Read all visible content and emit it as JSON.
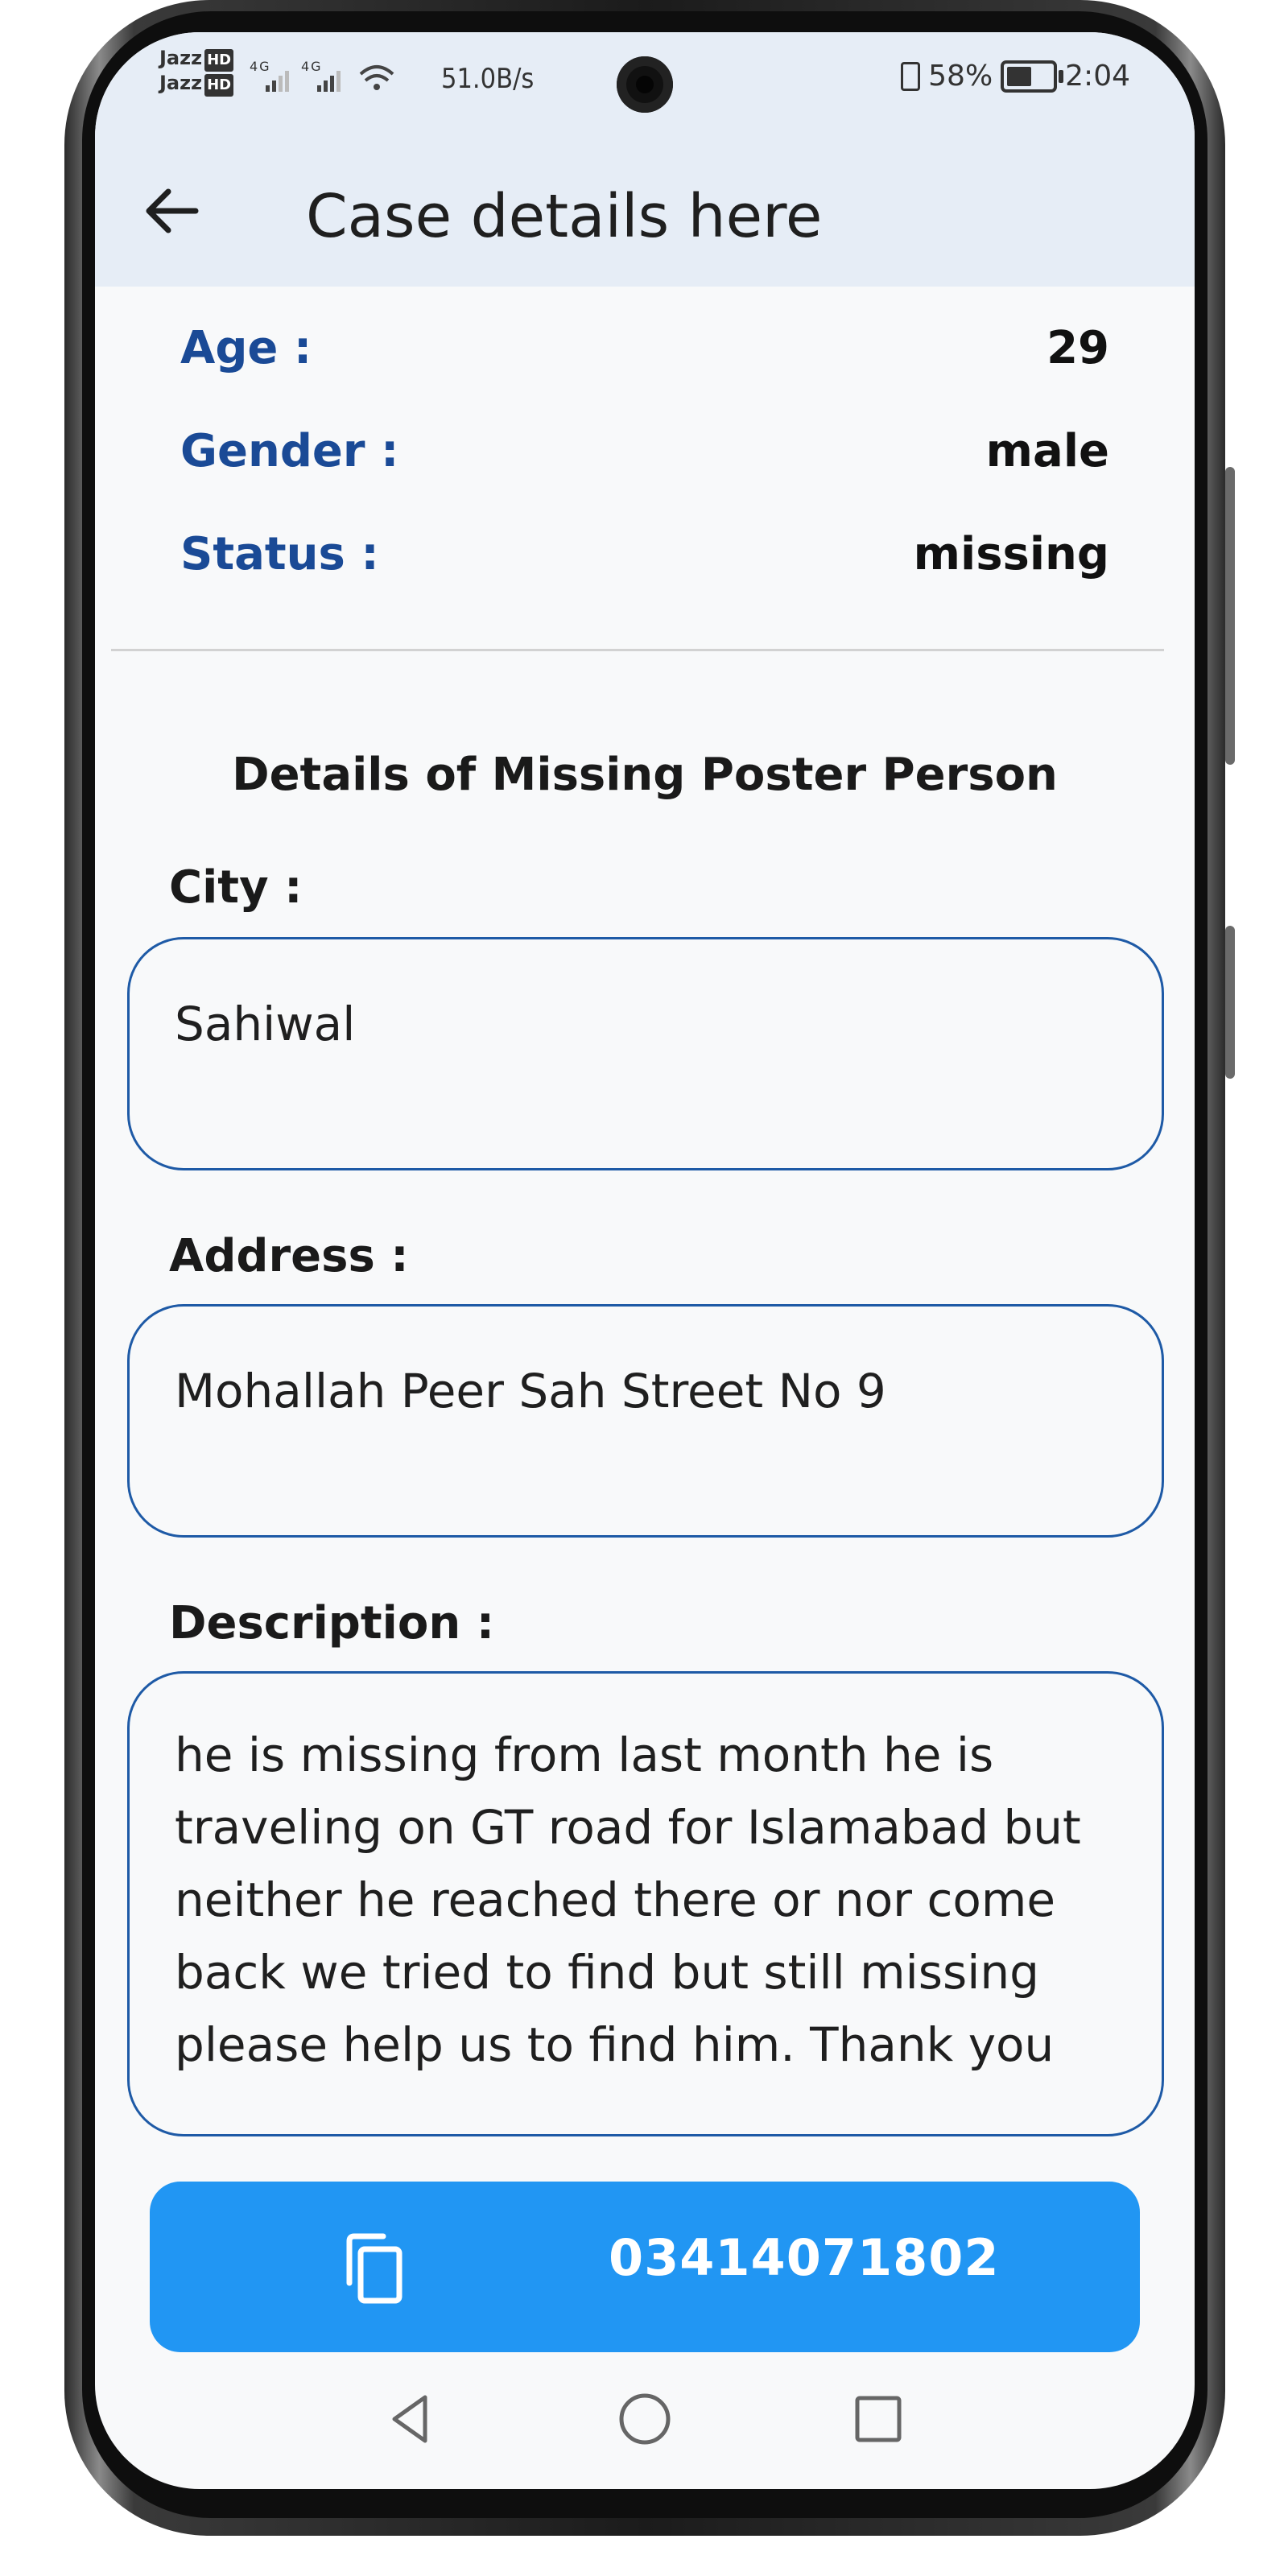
{
  "status_bar": {
    "carrier_1": "Jazz",
    "carrier_2": "Jazz",
    "hd_badge": "HD",
    "network_type": "4G",
    "net_speed": "51.0B/s",
    "battery_percent": "58%",
    "time": "2:04"
  },
  "header": {
    "title": "Case details here",
    "back_icon": "arrow-left-icon"
  },
  "case_info": [
    {
      "label": "Age :",
      "value": "29"
    },
    {
      "label": "Gender :",
      "value": "male"
    },
    {
      "label": "Status :",
      "value": "missing"
    }
  ],
  "poster_section": {
    "title": "Details of Missing Poster Person",
    "city_label": "City :",
    "city_value": "Sahiwal",
    "address_label": "Address :",
    "address_value": "Mohallah Peer Sah Street No 9",
    "description_label": "Description :",
    "description_value": "he is missing from last month he is traveling on GT road for Islamabad but neither he reached there or nor come back we tried to find but still missing please help us to find him. Thank you"
  },
  "contact_button": {
    "icon": "copy-icon",
    "phone": "03414071802",
    "color": "#2196f3"
  },
  "nav_bar": {
    "back_icon": "nav-back-icon",
    "home_icon": "nav-home-icon",
    "recents_icon": "nav-recents-icon"
  },
  "colors": {
    "label_blue": "#1a4a96",
    "border_blue": "#1e5aa6",
    "app_bar_bg": "#e6edf6"
  }
}
